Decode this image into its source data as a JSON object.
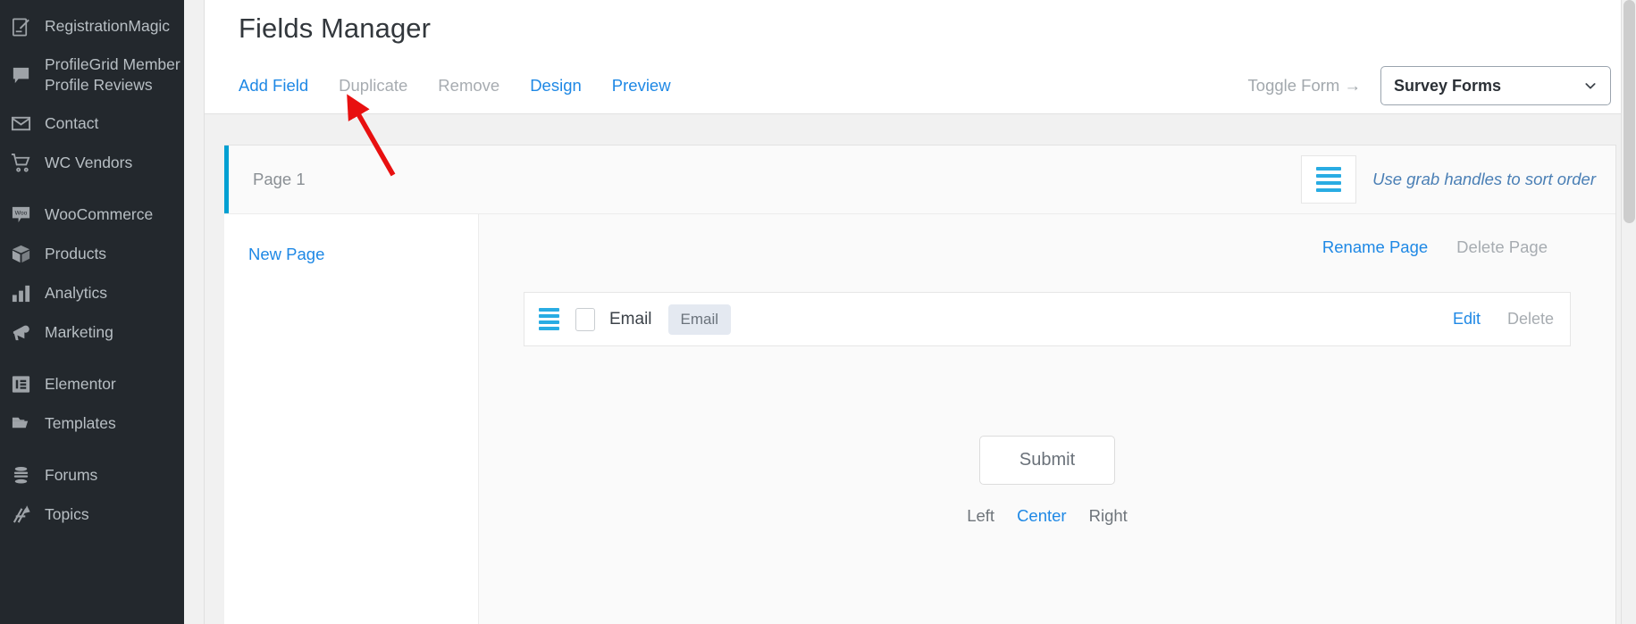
{
  "sidebar": {
    "items": [
      {
        "label": "RegistrationMagic",
        "icon": "registration-magic-icon",
        "separator": false
      },
      {
        "label": "ProfileGrid Member\nProfile Reviews",
        "icon": "comment-icon",
        "separator": false
      },
      {
        "label": "Contact",
        "icon": "envelope-icon",
        "separator": false
      },
      {
        "label": "WC Vendors",
        "icon": "cart-icon",
        "separator": false
      },
      {
        "label": "WooCommerce",
        "icon": "woocommerce-icon",
        "separator": true
      },
      {
        "label": "Products",
        "icon": "box-icon",
        "separator": false
      },
      {
        "label": "Analytics",
        "icon": "bar-chart-icon",
        "separator": false
      },
      {
        "label": "Marketing",
        "icon": "megaphone-icon",
        "separator": false
      },
      {
        "label": "Elementor",
        "icon": "elementor-icon",
        "separator": true
      },
      {
        "label": "Templates",
        "icon": "folder-icon",
        "separator": false
      },
      {
        "label": "Forums",
        "icon": "forums-icon",
        "separator": true
      },
      {
        "label": "Topics",
        "icon": "topics-icon",
        "separator": false
      }
    ]
  },
  "header": {
    "title": "Fields Manager",
    "toolbar": [
      {
        "label": "Add Field",
        "state": "active"
      },
      {
        "label": "Duplicate",
        "state": "muted"
      },
      {
        "label": "Remove",
        "state": "muted"
      },
      {
        "label": "Design",
        "state": "active"
      },
      {
        "label": "Preview",
        "state": "active"
      }
    ],
    "toggle_form_label": "Toggle Form →",
    "form_select": {
      "value": "Survey Forms",
      "icon": "chevron-down-icon"
    }
  },
  "builder": {
    "page_tab": {
      "name": "Page 1",
      "accent_color": "#00a0d2"
    },
    "grab": {
      "handle_icon": "grab-handle-icon",
      "hint": "Use grab handles to sort order"
    },
    "left_pane": {
      "new_page_label": "New Page"
    },
    "page_actions": [
      {
        "label": "Rename Page",
        "state": "blue"
      },
      {
        "label": "Delete Page",
        "state": "muted"
      }
    ],
    "fields": [
      {
        "handle_icon": "grab-handle-icon",
        "checkbox_checked": false,
        "label": "Email",
        "badge": "Email",
        "actions": [
          {
            "label": "Edit",
            "state": "blue"
          },
          {
            "label": "Delete",
            "state": "muted"
          }
        ]
      }
    ],
    "submit": {
      "label": "Submit",
      "alignment_options": [
        {
          "label": "Left",
          "state": "muted"
        },
        {
          "label": "Center",
          "state": "active"
        },
        {
          "label": "Right",
          "state": "muted"
        }
      ]
    }
  },
  "annotation": {
    "arrow_color": "#e81010",
    "arrow_target": "Add Field"
  },
  "colors": {
    "accent_blue": "#1e88e5",
    "accent_cyan": "#00a0d2",
    "handle_cyan": "#29ace3",
    "sidebar_bg": "#23282d",
    "muted_text": "#a7acb1"
  }
}
